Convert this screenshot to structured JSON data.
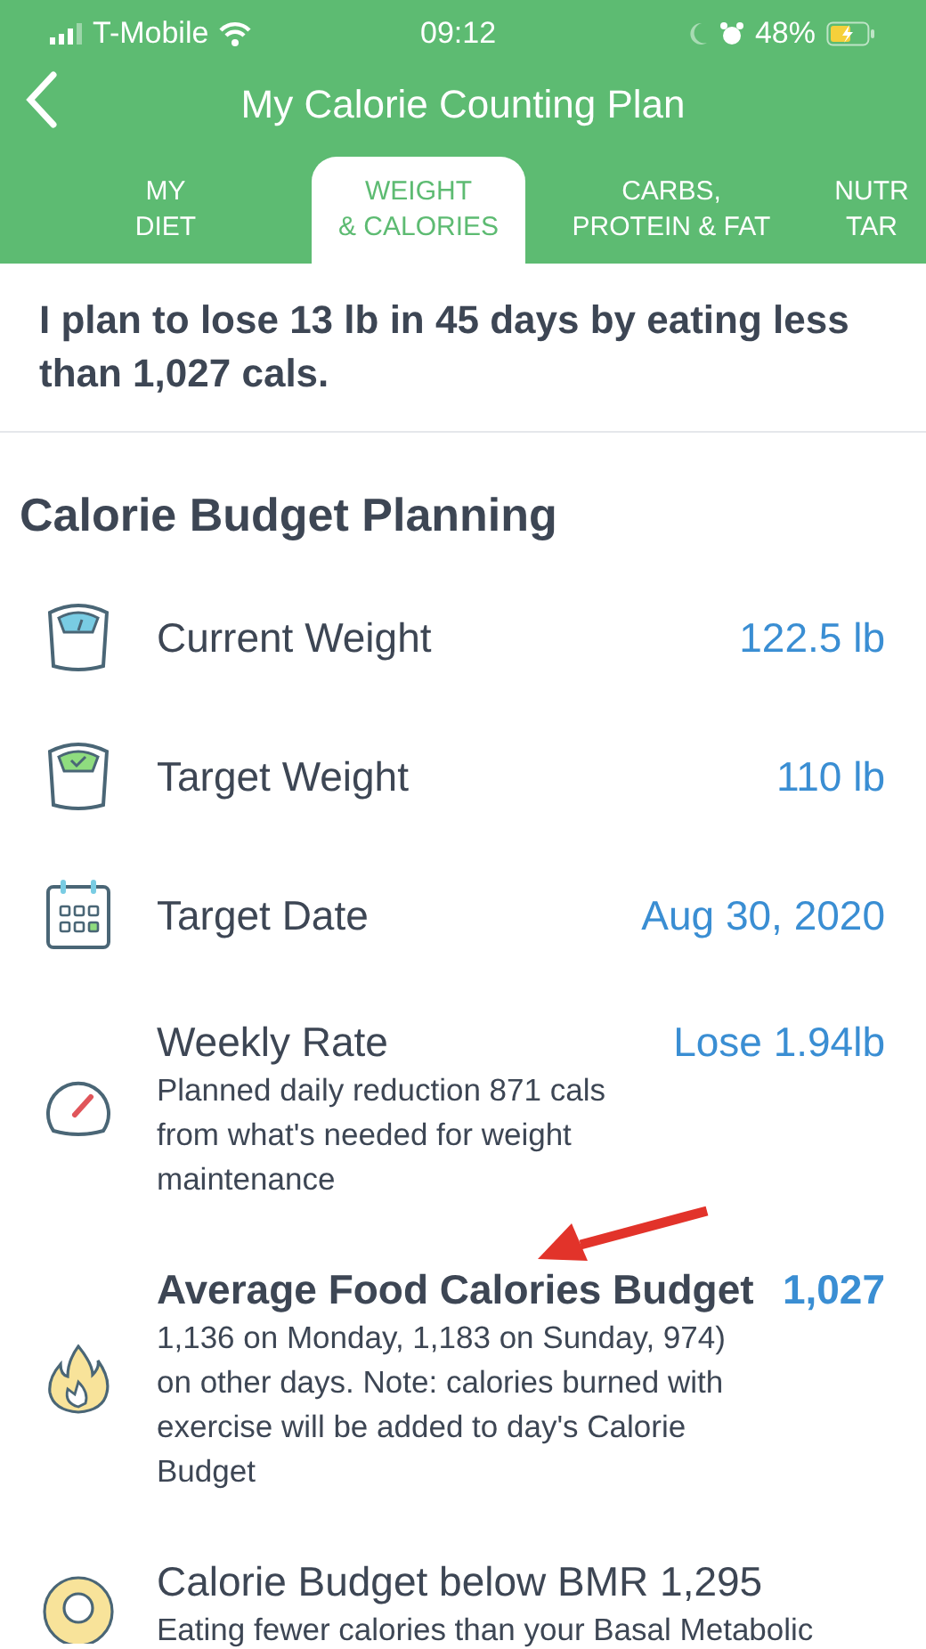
{
  "status_bar": {
    "carrier": "T-Mobile",
    "time": "09:12",
    "battery": "48%"
  },
  "header": {
    "title": "My Calorie Counting Plan"
  },
  "tabs": [
    {
      "lines": [
        "MY",
        "DIET"
      ],
      "selected": false
    },
    {
      "lines": [
        "WEIGHT",
        "& CALORIES"
      ],
      "selected": true
    },
    {
      "lines": [
        "CARBS,",
        "PROTEIN & FAT"
      ],
      "selected": false
    },
    {
      "lines": [
        "NUTR",
        "TAR"
      ],
      "selected": false
    }
  ],
  "summary": "I plan to lose 13 lb in 45 days by eating less than 1,027 cals.",
  "section_title": "Calorie Budget Planning",
  "rows": [
    {
      "kind": "simple",
      "title": "Current Weight",
      "value": "122.5 lb"
    },
    {
      "kind": "simple",
      "title": "Target Weight",
      "value": "110 lb"
    },
    {
      "kind": "simple",
      "title": "Target Date",
      "value": "Aug 30, 2020"
    },
    {
      "kind": "detail",
      "title": "Weekly Rate",
      "value": "Lose 1.94lb",
      "note": "Planned daily reduction 871 cals from what's needed for weight maintenance",
      "highlighted": false
    },
    {
      "kind": "detail",
      "title": "Average Food Calories Budget",
      "value": "1,027",
      "note": "1,136 on Monday, 1,183 on Sunday, 974) on other days. Note: calories burned with exercise will be added to day's Calorie Budget",
      "highlighted": true
    },
    {
      "kind": "detail",
      "title": "Calorie Budget below BMR 1,295",
      "note": "Eating fewer calories than your Basal Metabolic",
      "highlighted": false
    }
  ]
}
